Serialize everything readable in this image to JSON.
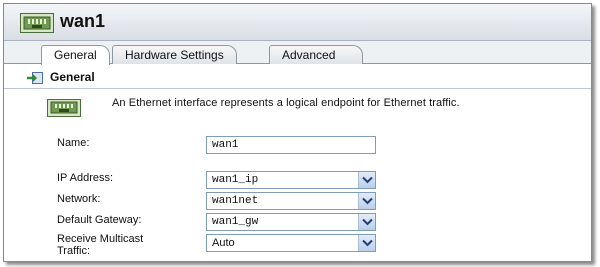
{
  "window": {
    "title": "wan1",
    "icon": "ethernet-port-icon"
  },
  "tabs": [
    {
      "label": "General",
      "active": true
    },
    {
      "label": "Hardware Settings",
      "active": false
    },
    {
      "label": "Advanced",
      "active": false
    }
  ],
  "section": {
    "title": "General",
    "icon": "arrow-into-box-icon"
  },
  "description": "An Ethernet interface represents a logical endpoint for Ethernet traffic.",
  "fields": {
    "name": {
      "label": "Name:",
      "value": "wan1"
    },
    "ip_address": {
      "label": "IP Address:",
      "value": "wan1_ip"
    },
    "network": {
      "label": "Network:",
      "value": "wan1net"
    },
    "default_gateway": {
      "label": "Default Gateway:",
      "value": "wan1_gw"
    },
    "receive_multicast": {
      "label_line1": "Receive Multicast",
      "label_line2": "Traffic:",
      "value": "Auto"
    }
  }
}
